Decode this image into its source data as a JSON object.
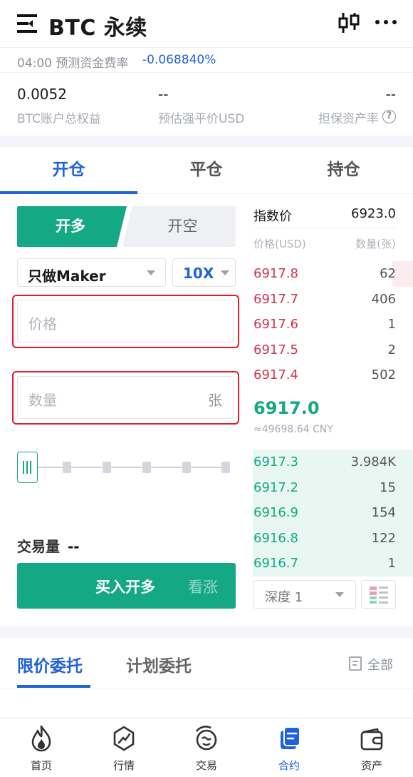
{
  "header": {
    "title": "BTC 永续"
  },
  "funding": {
    "label": "04:00 预测资金费率",
    "value": "-0.068840%"
  },
  "stats": [
    {
      "value": "0.0052",
      "label": "BTC账户总权益"
    },
    {
      "value": "--",
      "label": "预估强平价USD"
    },
    {
      "value": "--",
      "label": "担保资产率"
    }
  ],
  "tabs": [
    "开仓",
    "平仓",
    "持仓"
  ],
  "order": {
    "long_label": "开多",
    "short_label": "开空",
    "type_value": "只做Maker",
    "leverage_value": "10X",
    "price_placeholder": "价格",
    "qty_placeholder": "数量",
    "qty_unit": "张",
    "volume_label": "交易量",
    "volume_value": "--",
    "buy_label": "买入开多",
    "buy_sub": "看涨"
  },
  "orderbook": {
    "index_label": "指数价",
    "index_value": "6923.0",
    "col_price": "价格(USD)",
    "col_qty": "数量(张)",
    "asks": [
      {
        "price": "6917.8",
        "qty": "62",
        "depth": 0.13
      },
      {
        "price": "6917.7",
        "qty": "406",
        "depth": 0.0
      },
      {
        "price": "6917.6",
        "qty": "1",
        "depth": 0.0
      },
      {
        "price": "6917.5",
        "qty": "2",
        "depth": 0.0
      },
      {
        "price": "6917.4",
        "qty": "502",
        "depth": 0.0
      }
    ],
    "last_price": "6917.0",
    "last_cny": "≈49698.64 CNY",
    "bids": [
      {
        "price": "6917.3",
        "qty": "3.984K",
        "depth": 1.0
      },
      {
        "price": "6917.2",
        "qty": "15",
        "depth": 1.0
      },
      {
        "price": "6916.9",
        "qty": "154",
        "depth": 1.0
      },
      {
        "price": "6916.8",
        "qty": "122",
        "depth": 1.0
      },
      {
        "price": "6916.7",
        "qty": "1",
        "depth": 1.0
      }
    ],
    "depth_select": "深度 1"
  },
  "orders_tabs": {
    "limit": "限价委托",
    "plan": "计划委托",
    "all": "全部"
  },
  "nav": [
    "首页",
    "行情",
    "交易",
    "合约",
    "资产"
  ],
  "colors": {
    "accent": "#1f62d9",
    "buy": "#14a884",
    "sell": "#d2344e"
  }
}
